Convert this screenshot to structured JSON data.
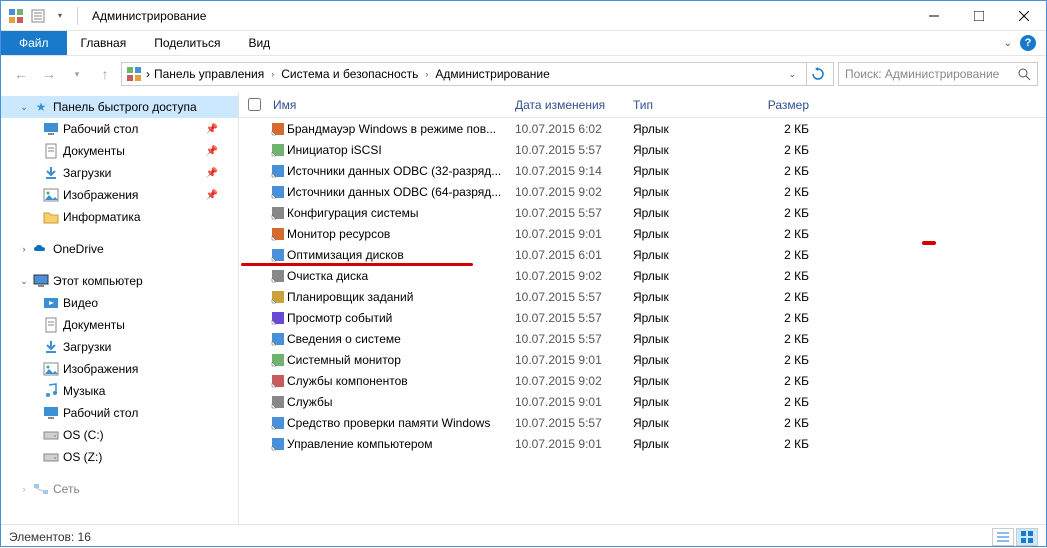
{
  "window": {
    "title": "Администрирование"
  },
  "ribbon": {
    "file": "Файл",
    "tabs": [
      "Главная",
      "Поделиться",
      "Вид"
    ]
  },
  "breadcrumb": {
    "items": [
      "Панель управления",
      "Система и безопасность",
      "Администрирование"
    ]
  },
  "search": {
    "placeholder": "Поиск: Администрирование"
  },
  "sidebar": {
    "quick_access": {
      "label": "Панель быстрого доступа",
      "selected": true
    },
    "qa_items": [
      {
        "label": "Рабочий стол",
        "pin": true,
        "icon": "desktop"
      },
      {
        "label": "Документы",
        "pin": true,
        "icon": "document"
      },
      {
        "label": "Загрузки",
        "pin": true,
        "icon": "download"
      },
      {
        "label": "Изображения",
        "pin": true,
        "icon": "pictures"
      },
      {
        "label": "Информатика",
        "pin": false,
        "icon": "folder"
      }
    ],
    "onedrive": {
      "label": "OneDrive"
    },
    "thispc": {
      "label": "Этот компьютер"
    },
    "pc_items": [
      {
        "label": "Видео",
        "icon": "video"
      },
      {
        "label": "Документы",
        "icon": "document"
      },
      {
        "label": "Загрузки",
        "icon": "download"
      },
      {
        "label": "Изображения",
        "icon": "pictures"
      },
      {
        "label": "Музыка",
        "icon": "music"
      },
      {
        "label": "Рабочий стол",
        "icon": "desktop"
      },
      {
        "label": "OS (C:)",
        "icon": "drive"
      },
      {
        "label": "OS (Z:)",
        "icon": "drive"
      }
    ],
    "network": {
      "label": "Сеть"
    }
  },
  "columns": {
    "name": "Имя",
    "date": "Дата изменения",
    "type": "Тип",
    "size": "Размер"
  },
  "files": [
    {
      "name": "Брандмауэр Windows в режиме пов...",
      "date": "10.07.2015 6:02",
      "type": "Ярлык",
      "size": "2 КБ"
    },
    {
      "name": "Инициатор iSCSI",
      "date": "10.07.2015 5:57",
      "type": "Ярлык",
      "size": "2 КБ"
    },
    {
      "name": "Источники данных ODBC (32-разряд...",
      "date": "10.07.2015 9:14",
      "type": "Ярлык",
      "size": "2 КБ"
    },
    {
      "name": "Источники данных ODBC (64-разряд...",
      "date": "10.07.2015 9:02",
      "type": "Ярлык",
      "size": "2 КБ"
    },
    {
      "name": "Конфигурация системы",
      "date": "10.07.2015 5:57",
      "type": "Ярлык",
      "size": "2 КБ"
    },
    {
      "name": "Монитор ресурсов",
      "date": "10.07.2015 9:01",
      "type": "Ярлык",
      "size": "2 КБ"
    },
    {
      "name": "Оптимизация дисков",
      "date": "10.07.2015 6:01",
      "type": "Ярлык",
      "size": "2 КБ"
    },
    {
      "name": "Очистка диска",
      "date": "10.07.2015 9:02",
      "type": "Ярлык",
      "size": "2 КБ"
    },
    {
      "name": "Планировщик заданий",
      "date": "10.07.2015 5:57",
      "type": "Ярлык",
      "size": "2 КБ"
    },
    {
      "name": "Просмотр событий",
      "date": "10.07.2015 5:57",
      "type": "Ярлык",
      "size": "2 КБ"
    },
    {
      "name": "Сведения о системе",
      "date": "10.07.2015 5:57",
      "type": "Ярлык",
      "size": "2 КБ"
    },
    {
      "name": "Системный монитор",
      "date": "10.07.2015 9:01",
      "type": "Ярлык",
      "size": "2 КБ"
    },
    {
      "name": "Службы компонентов",
      "date": "10.07.2015 9:02",
      "type": "Ярлык",
      "size": "2 КБ"
    },
    {
      "name": "Службы",
      "date": "10.07.2015 9:01",
      "type": "Ярлык",
      "size": "2 КБ"
    },
    {
      "name": "Средство проверки памяти Windows",
      "date": "10.07.2015 5:57",
      "type": "Ярлык",
      "size": "2 КБ"
    },
    {
      "name": "Управление компьютером",
      "date": "10.07.2015 9:01",
      "type": "Ярлык",
      "size": "2 КБ"
    }
  ],
  "status": {
    "count_label": "Элементов: 16"
  }
}
